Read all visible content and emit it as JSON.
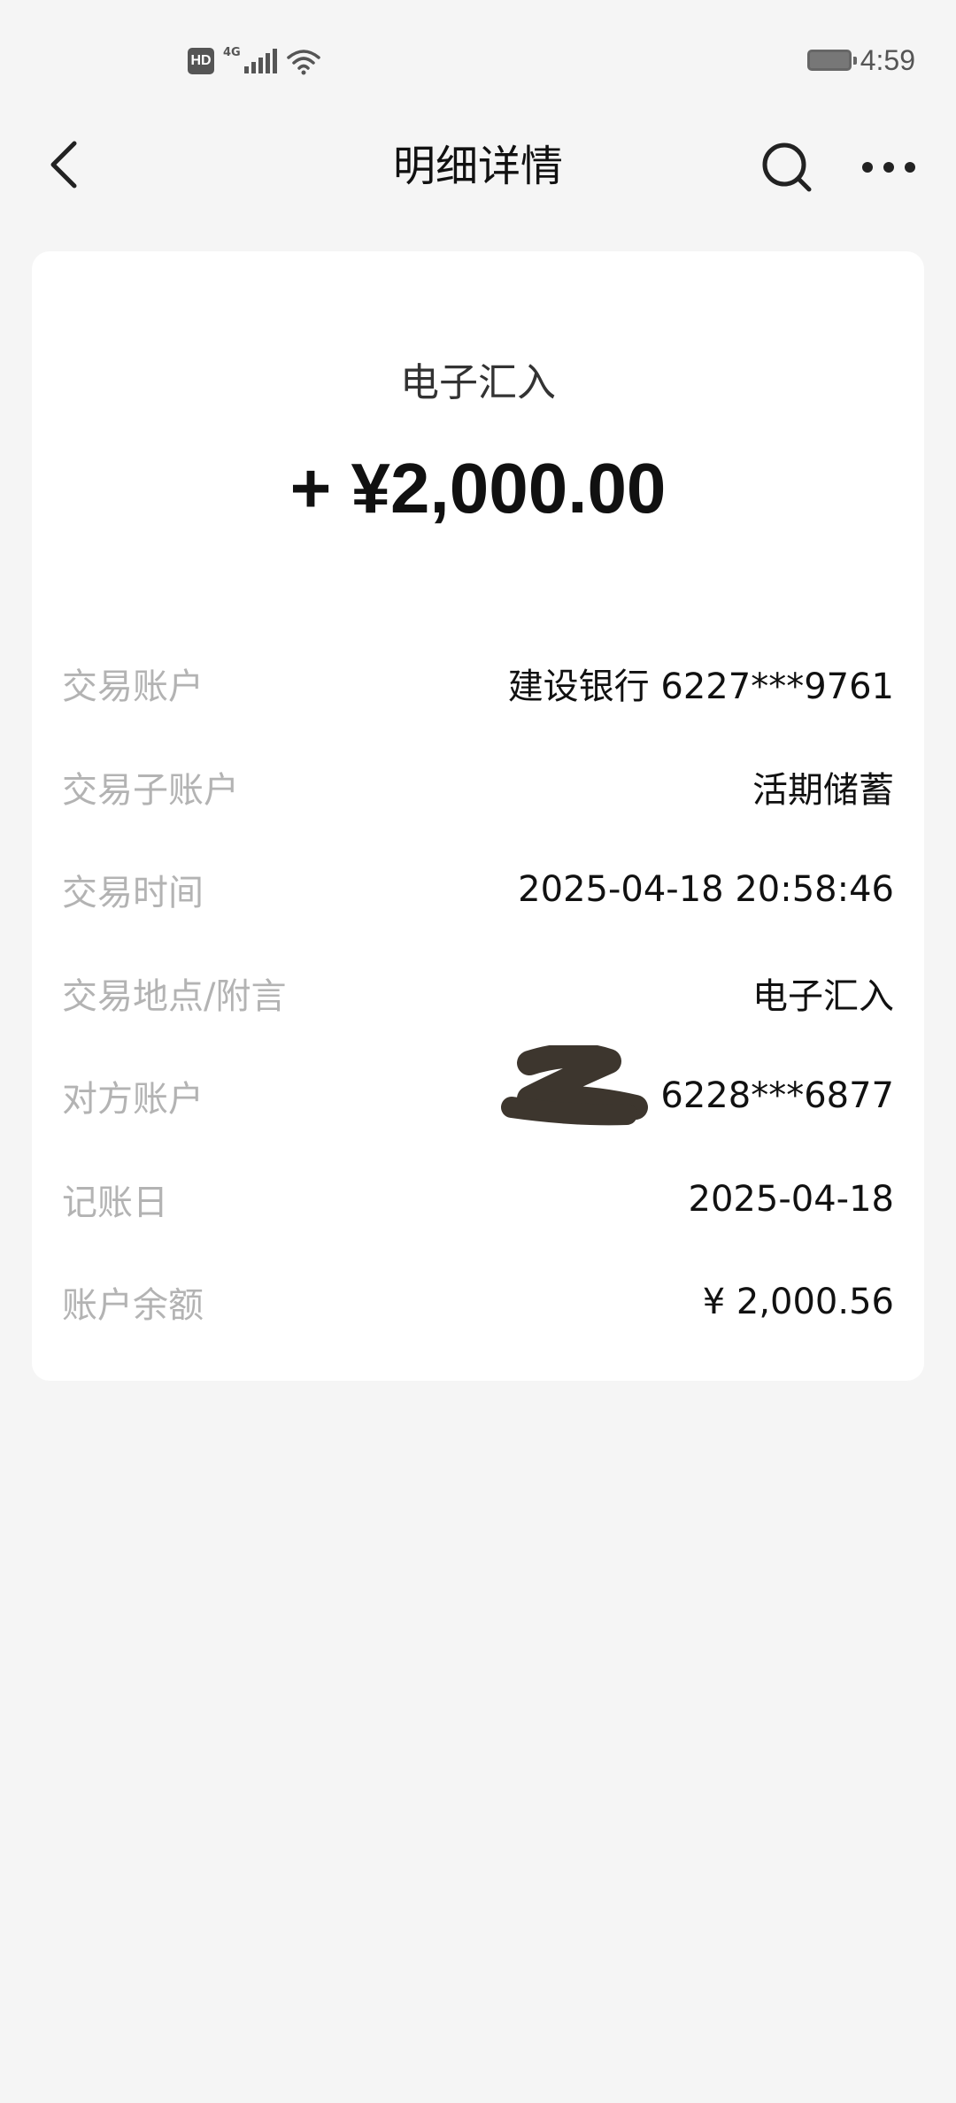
{
  "status_bar": {
    "hd_badge": "HD",
    "network": "4G",
    "time": "4:59"
  },
  "nav": {
    "title": "明细详情",
    "icons": [
      "chevron-left-icon",
      "search-icon",
      "more-icon"
    ]
  },
  "transaction": {
    "type": "电子汇入",
    "amount": "+ ¥2,000.00"
  },
  "details": [
    {
      "label": "交易账户",
      "value": "建设银行 6227***9761"
    },
    {
      "label": "交易子账户",
      "value": "活期储蓄"
    },
    {
      "label": "交易时间",
      "value": "2025-04-18 20:58:46"
    },
    {
      "label": "交易地点/附言",
      "value": "电子汇入"
    },
    {
      "label": "对方账户",
      "value": "6228***6877",
      "redacted": true
    },
    {
      "label": "记账日",
      "value": "2025-04-18"
    },
    {
      "label": "账户余额",
      "value": "¥ 2,000.56"
    }
  ],
  "colors": {
    "background": "#f5f5f5",
    "card": "#ffffff",
    "label": "#b3b3b3",
    "text": "#111111",
    "redaction": "#3d362e"
  }
}
